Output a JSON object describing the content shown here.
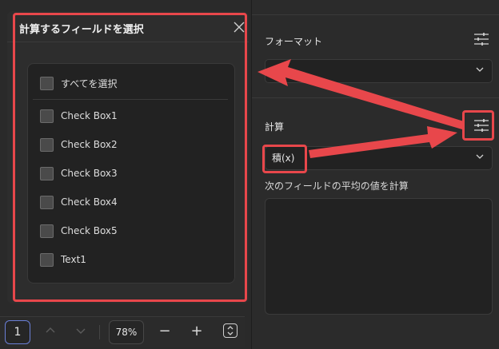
{
  "dialog": {
    "title": "計算するフィールドを選択",
    "select_all_label": "すべてを選択",
    "items": [
      {
        "label": "Check Box1"
      },
      {
        "label": "Check Box2"
      },
      {
        "label": "Check Box3"
      },
      {
        "label": "Check Box4"
      },
      {
        "label": "Check Box5"
      },
      {
        "label": "Text1"
      }
    ]
  },
  "toolbar": {
    "page_number": "1",
    "zoom_level": "78%",
    "zoom_out_label": "−",
    "zoom_in_label": "+"
  },
  "properties": {
    "format_label": "フォーマット",
    "format_value": "",
    "calc_label": "計算",
    "calc_value": "積(x)",
    "calc_description": "次のフィールドの平均の値を計算",
    "calc_text": ""
  },
  "colors": {
    "highlight": "#e8474b",
    "background": "#2b2b2b",
    "page_box_border": "#6a7fd6"
  }
}
